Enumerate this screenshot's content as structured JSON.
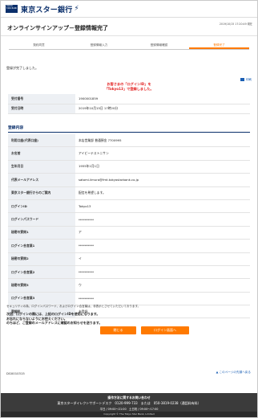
{
  "header": {
    "logo_mark": "TOKYO STAR BANK",
    "logo_text": "東京スター銀行",
    "logo_symbol": "⚡"
  },
  "page": {
    "title": "オンラインサインアップ－登録情報完了",
    "timestamp": "2019/10/15 17:20:49 現在"
  },
  "steps": [
    {
      "label": "契約同意",
      "active": false
    },
    {
      "label": "登録情報入力",
      "active": false
    },
    {
      "label": "登録情報確認",
      "active": false
    },
    {
      "label": "登録完了",
      "active": true
    }
  ],
  "done_message": "登録が完了しました。",
  "notice": {
    "line1": "お客さまの「ログインID」を",
    "line2": "「Tokyo13」で登録しました。"
  },
  "print_label": "印刷",
  "receipt": [
    {
      "label": "受付番号",
      "value": "1900001859"
    },
    {
      "label": "受付日時",
      "value": "2019年10月15日 17時20分"
    }
  ],
  "section_title": "登録内容",
  "details": [
    {
      "label": "利用口座(代表口座)",
      "value": "本店営業部 普通預金 7700995"
    },
    {
      "label": "お名前",
      "value": "アイビーテストニサン"
    },
    {
      "label": "生年月日",
      "value": "1955年1月1日"
    },
    {
      "label": "代表メールアドレス",
      "value": "satomi.iimura@fmt.tokyostarbank.co.jp"
    },
    {
      "label": "東京スター銀行からのご案内",
      "value": "配信を希望します。"
    },
    {
      "label": "ログインID",
      "value": "Tokyo13"
    },
    {
      "label": "ログインパスワード",
      "value": "**********"
    },
    {
      "label": "秘密の質問1",
      "value": "ア"
    },
    {
      "label": "ログイン合言葉1",
      "value": "**********"
    },
    {
      "label": "秘密の質問2",
      "value": "イ"
    },
    {
      "label": "ログイン合言葉2",
      "value": "**********"
    },
    {
      "label": "秘密の質問3",
      "value": "ウ"
    },
    {
      "label": "ログイン合言葉3",
      "value": "**********"
    },
    {
      "label": "登録料",
      "value": "未登録"
    }
  ],
  "security_note": "セキュリティの為、ログインパスワード、およびログイン合言葉は、非表示とさせていただいております。",
  "bold_note": {
    "line1": "次回、ログインの際には、上記のログインIDを使用になります。",
    "line2": "お忘れにならないようにお控えください。",
    "line3": "のちほど、ご登録のメールアドレスに確認のお知らせを送ります。"
  },
  "buttons": {
    "close": "閉じる",
    "login": "ログイン画面へ"
  },
  "page_code": "DG0010315",
  "to_top": "このページの先頭へ戻る",
  "footer": {
    "line1": "操作方法に関するお問い合わせ",
    "line2": "東京スターダイレクトサポートデスク　0120-999-733　または　050-3819-0238（通話料有料）",
    "line3": "平日 / 09:00～21:00　土日祝 / 09:00～17:00",
    "copyright": "Copyright © The Tokyo Star Bank, Limited"
  },
  "colors": {
    "brand_navy": "#0a2f6b",
    "accent_orange": "#ff7a00",
    "alert_red": "#e21b1b",
    "link_blue": "#1a5fb4"
  }
}
